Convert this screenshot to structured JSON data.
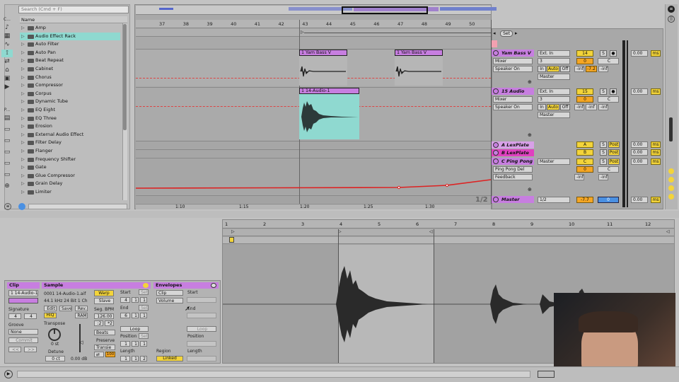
{
  "browser": {
    "search_placeholder": "Search (Cmd + F)",
    "column_header": "Name",
    "items": [
      "Amp",
      "Audio Effect Rack",
      "Auto Filter",
      "Auto Pan",
      "Beat Repeat",
      "Cabinet",
      "Chorus",
      "Compressor",
      "Corpus",
      "Dynamic Tube",
      "EQ Eight",
      "EQ Three",
      "Erosion",
      "External Audio Effect",
      "Filter Delay",
      "Flanger",
      "Frequency Shifter",
      "Gate",
      "Glue Compressor",
      "Grain Delay",
      "Limiter"
    ],
    "selected_index": 1,
    "side_letters": [
      "C...",
      "P..."
    ]
  },
  "arrangement": {
    "bar_numbers": [
      "37",
      "38",
      "39",
      "40",
      "41",
      "42",
      "43",
      "44",
      "45",
      "46",
      "47",
      "48",
      "49",
      "50"
    ],
    "time_labels": [
      "1:10",
      "1:15",
      "1:20",
      "1:25",
      "1:30"
    ],
    "set_label": "Set",
    "page_indicator": "1/2",
    "clips": {
      "bass1": "1 Yam Bass V",
      "bass2": "1 Yam Bass V",
      "audio": "1 14-Audio-1"
    }
  },
  "mixer": {
    "tracks": [
      {
        "name": "Yam Bass V",
        "input": "Ext. In",
        "sub": "Mixer",
        "sub_num": "3",
        "monitor": "Speaker On",
        "out": "Master",
        "num": "14",
        "vol": "0",
        "pan": "C",
        "inf1": "-inf",
        "val": "-7.2",
        "inf2": "-inf",
        "delay": "0.00",
        "unit": "ms"
      },
      {
        "name": "15 Audio",
        "input": "Ext. In",
        "sub": "Mixer",
        "sub_num": "3",
        "monitor": "Speaker On",
        "out": "Master",
        "num": "15",
        "vol": "0",
        "pan": "C",
        "inf1": "-inf",
        "val": "-inf",
        "inf2": "-inf",
        "delay": "0.00",
        "unit": "ms"
      }
    ],
    "returns": [
      {
        "name": "A LexPlate",
        "letter": "A",
        "delay": "0.00",
        "unit": "ms"
      },
      {
        "name": "B LexPlate",
        "letter": "B",
        "delay": "0.00",
        "unit": "ms"
      },
      {
        "name": "C Ping Pong",
        "letter": "C",
        "out": "Master",
        "dev1": "Ping Pong Del",
        "dev2": "Feedback",
        "vol": "0",
        "pan": "C",
        "inf1": "-inf",
        "inf2": "-inf",
        "delay": "0.00",
        "unit": "ms"
      }
    ],
    "monitor_labels": [
      "In",
      "Auto",
      "Off"
    ],
    "solo": "S",
    "post": "Post",
    "master": {
      "name": "Master",
      "routing": "1/2",
      "val": "-7.7",
      "vol": "0",
      "delay": "0.00",
      "unit": "ms"
    },
    "colors": {
      "clip": "#c77ee0",
      "orange": "#f5a623",
      "yellow": "#f3d43a",
      "accent": "#8fd9d0",
      "automation": "#d22"
    }
  },
  "clip_view": {
    "clip": {
      "header": "Clip",
      "name": "1 14-Audio-1",
      "signature_label": "Signature",
      "sig_num": "4",
      "sig_den": "4",
      "groove_label": "Groove",
      "groove": "None",
      "commit": "Commit"
    },
    "sample": {
      "header": "Sample",
      "file": "0001 14-Audio-1.aif",
      "format": "44.1 kHz 24 Bit 1 Ch",
      "edit": "Edit",
      "save": "Save",
      "rev": "Rev.",
      "hiq": "HiQ",
      "ram": "RAM",
      "transpose_label": "Transpose",
      "transpose": "0 st",
      "detune_label": "Detune",
      "detune": "0 ct",
      "gain": "0.00 dB",
      "warp": "Warp",
      "slave": "Slave",
      "seg_bpm_label": "Seg. BPM",
      "seg_bpm": "126.00",
      "half": ":2",
      "double": "*2",
      "mode": "Beats",
      "preserve_label": "Preserve",
      "preserve": "Transie",
      "warp_val": "100"
    },
    "markers": {
      "start": "Start",
      "end": "End",
      "loop": "Loop",
      "position": "Position",
      "length": "Length",
      "set": "Set",
      "start_vals": [
        "4",
        "1",
        "1"
      ],
      "end_vals": [
        "6",
        "1",
        "1"
      ],
      "pos_vals": [
        "1",
        "1",
        "1"
      ],
      "len_vals": [
        "1",
        "1",
        "2"
      ]
    },
    "envelopes": {
      "header": "Envelopes",
      "source": "Clip",
      "control": "Volume",
      "start": "Start",
      "end": "End",
      "loop": "Loop",
      "position": "Position",
      "length": "Length",
      "region_label": "Region",
      "linked": "Linked"
    },
    "ruler_numbers": [
      "1",
      "2",
      "3",
      "4",
      "5",
      "6",
      "7",
      "8",
      "9",
      "10",
      "11",
      "12"
    ]
  }
}
